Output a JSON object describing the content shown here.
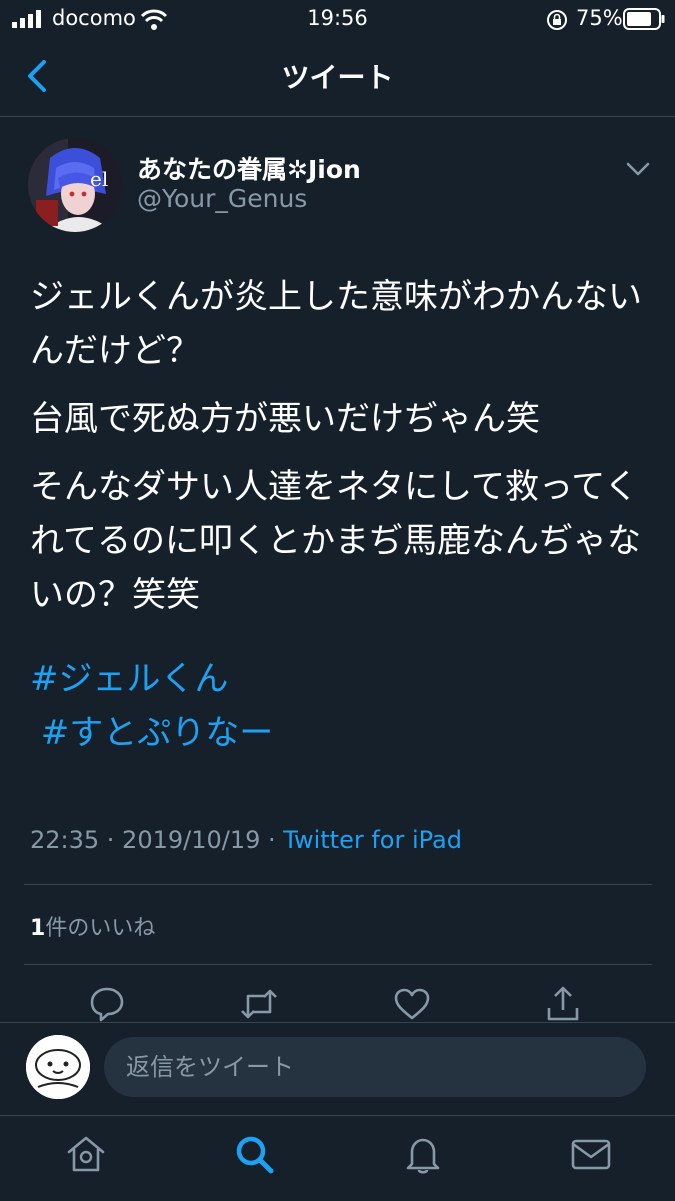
{
  "status_bar": {
    "carrier": "docomo",
    "time": "19:56",
    "battery": "75%"
  },
  "header": {
    "title": "ツイート",
    "back_icon": "chevron-left-icon"
  },
  "tweet": {
    "author_name": "あなたの眷属✲Jion",
    "author_handle": "@Your_Genus",
    "paragraphs": [
      "ジェルくんが炎上した意味がわかんないんだけど？",
      "台風で死ぬ方が悪いだけぢゃん笑",
      "そんなダサい人達をネタにして救ってくれてるのに叩くとかまぢ馬鹿なんぢゃないの？笑笑"
    ],
    "hashtags": [
      "#ジェルくん",
      " #すとぷりなー"
    ],
    "timestamp": "22:35 · 2019/10/19 · ",
    "source": "Twitter for iPad",
    "likes_count": "1",
    "likes_label": "件のいいね"
  },
  "actions": [
    "reply-icon",
    "retweet-icon",
    "like-icon",
    "share-icon"
  ],
  "reply": {
    "placeholder": "返信をツイート"
  },
  "tabs": [
    "home-icon",
    "search-icon",
    "notifications-icon",
    "messages-icon"
  ],
  "colors": {
    "background": "#15202b",
    "accent": "#1da1f2",
    "secondary_text": "#8899a6",
    "divider": "#38444d"
  }
}
